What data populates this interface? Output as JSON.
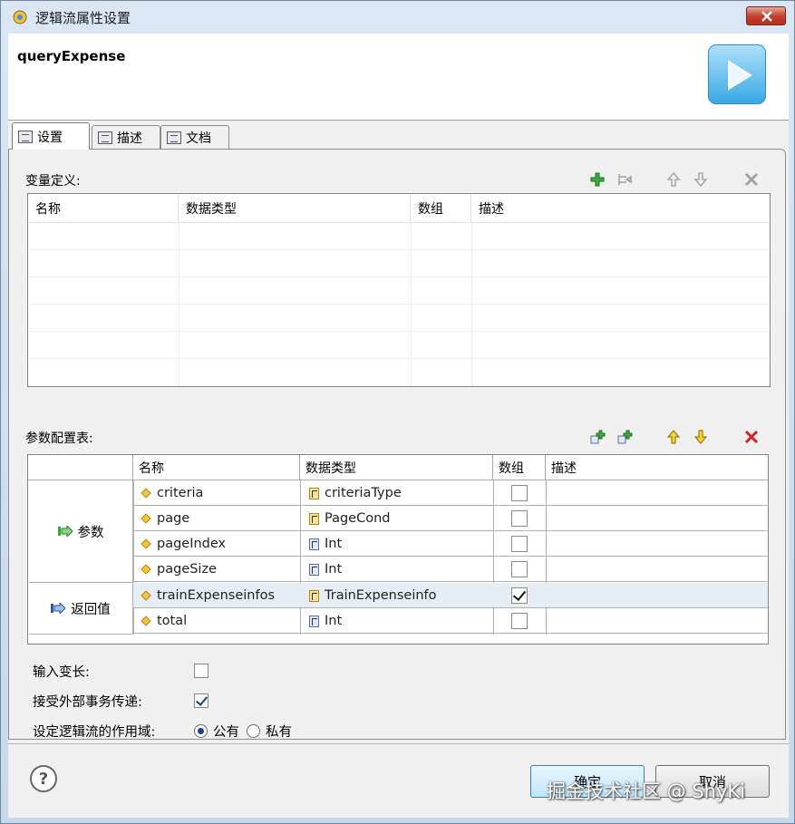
{
  "window": {
    "title": "逻辑流属性设置"
  },
  "header": {
    "flow_name": "queryExpense"
  },
  "tabs": [
    {
      "label": "设置",
      "active": true
    },
    {
      "label": "描述",
      "active": false
    },
    {
      "label": "文档",
      "active": false
    }
  ],
  "variables": {
    "label": "变量定义:",
    "columns": [
      "名称",
      "数据类型",
      "数组",
      "描述"
    ]
  },
  "params": {
    "label": "参数配置表:",
    "columns": [
      "名称",
      "数据类型",
      "数组",
      "描述"
    ],
    "groups": [
      {
        "label": "参数",
        "rows": [
          {
            "name": "criteria",
            "type": "criteriaType",
            "array": false
          },
          {
            "name": "page",
            "type": "PageCond",
            "array": false
          },
          {
            "name": "pageIndex",
            "type": "Int",
            "array": false
          },
          {
            "name": "pageSize",
            "type": "Int",
            "array": false
          }
        ]
      },
      {
        "label": "返回值",
        "rows": [
          {
            "name": "trainExpenseinfos",
            "type": "TrainExpenseinfo",
            "array": true
          },
          {
            "name": "total",
            "type": "Int",
            "array": false
          }
        ]
      }
    ]
  },
  "options": {
    "variable_length": {
      "label": "输入变长:",
      "checked": false
    },
    "accept_transaction": {
      "label": "接受外部事务传递:",
      "checked": true
    },
    "scope": {
      "label": "设定逻辑流的作用域:",
      "public": "公有",
      "private": "私有",
      "selected": "public"
    }
  },
  "footer": {
    "ok": "确定",
    "cancel": "取消",
    "help": "?"
  },
  "watermark": "掘金技术社区 @ ShyKi"
}
